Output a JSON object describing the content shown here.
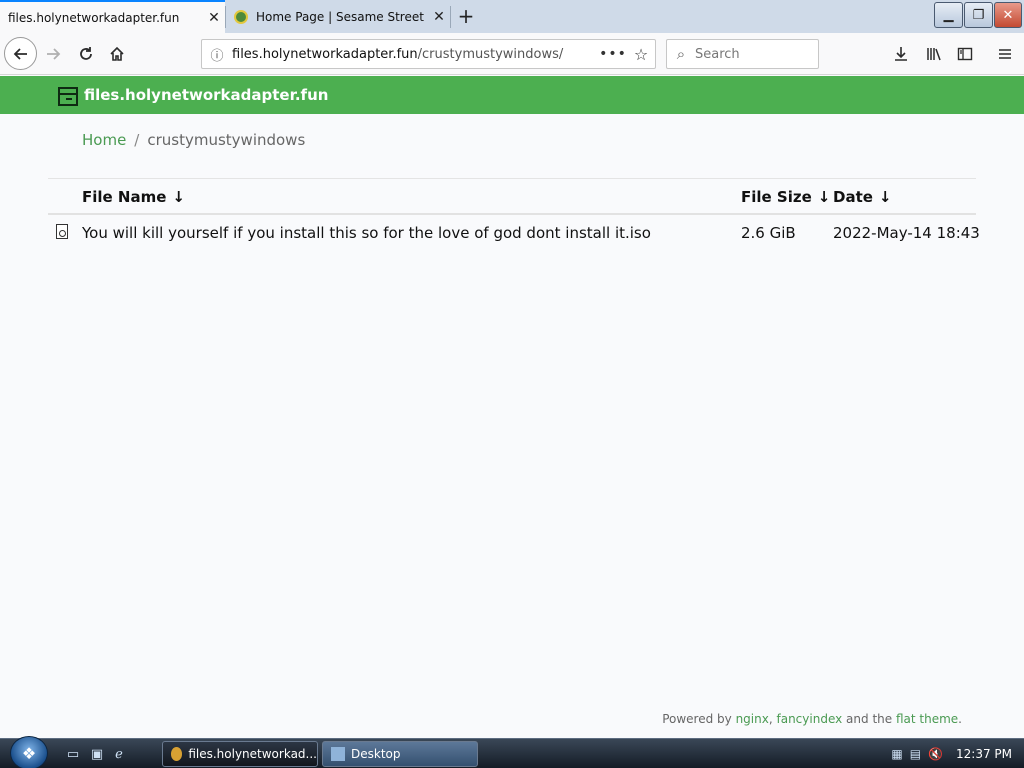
{
  "browser": {
    "tabs": [
      {
        "title": "files.holynetworkadapter.fun",
        "active": true
      },
      {
        "title": "Home Page | Sesame Street | PB",
        "active": false
      }
    ],
    "address": {
      "host": "files.holynetworkadapter.fun",
      "path": "/crustymustywindows/"
    },
    "search_placeholder": "Search"
  },
  "page": {
    "site_title": "files.holynetworkadapter.fun",
    "breadcrumb": {
      "home": "Home",
      "separator": "/",
      "current": "crustymustywindows"
    },
    "columns": {
      "name": "File Name",
      "size": "File Size",
      "date": "Date",
      "sort_arrow": "↓"
    },
    "files": [
      {
        "name": "You will kill yourself if you install this so for the love of god dont install it.iso",
        "size": "2.6 GiB",
        "date": "2022-May-14 18:43"
      }
    ],
    "footer": {
      "prefix": "Powered by",
      "link1": "nginx",
      "comma": ",",
      "link2": "fancyindex",
      "middle": "and the",
      "link3": "flat theme",
      "suffix": "."
    }
  },
  "taskbar": {
    "tasks": [
      "files.holynetworkad...",
      "Desktop"
    ],
    "clock": "12:37 PM"
  },
  "colors": {
    "header_green": "#4caf50",
    "link_green": "#4a9a52",
    "tab_accent": "#0a84ff"
  }
}
